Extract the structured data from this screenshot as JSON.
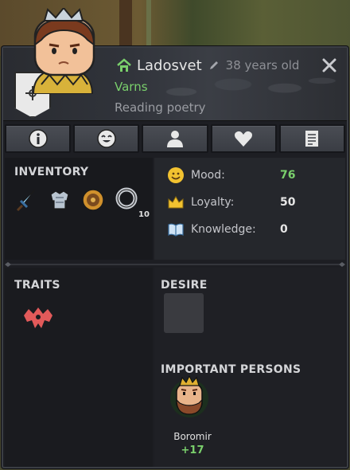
{
  "character": {
    "name": "Ladosvet",
    "age": "38 years old",
    "house": "Varns",
    "activity": "Reading poetry"
  },
  "tabs": [
    {
      "icon": "info-icon"
    },
    {
      "icon": "mood-face-icon"
    },
    {
      "icon": "person-icon"
    },
    {
      "icon": "heart-icon"
    },
    {
      "icon": "document-icon"
    }
  ],
  "inventory": {
    "title": "INVENTORY",
    "items": [
      {
        "icon": "sword-icon"
      },
      {
        "icon": "armor-icon"
      },
      {
        "icon": "shield-icon"
      },
      {
        "icon": "ring-icon",
        "count": "10"
      }
    ]
  },
  "stats": [
    {
      "icon": "smiley-icon",
      "label": "Mood:",
      "value": "76",
      "good": true
    },
    {
      "icon": "crown-icon",
      "label": "Loyalty:",
      "value": "50",
      "good": false
    },
    {
      "icon": "book-icon",
      "label": "Knowledge:",
      "value": "0",
      "good": false
    }
  ],
  "traits": {
    "title": "TRAITS",
    "items": [
      {
        "icon": "trait-crown-icon",
        "color": "#e25a5a"
      }
    ]
  },
  "desire": {
    "title": "DESIRE"
  },
  "important_persons": {
    "title": "IMPORTANT PERSONS",
    "people": [
      {
        "name": "Boromir",
        "score": "+17"
      }
    ]
  },
  "colors": {
    "positive": "#7ad06c",
    "panel": "#1d1e23"
  }
}
